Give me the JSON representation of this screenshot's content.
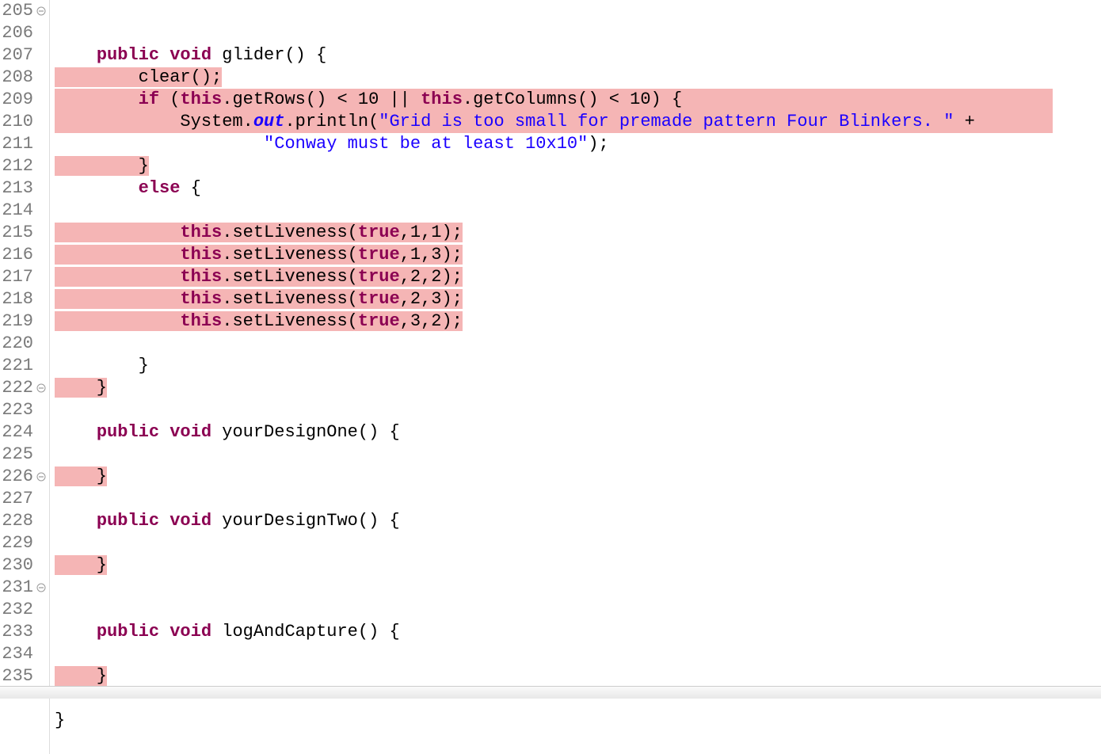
{
  "gutter": {
    "start": 205,
    "end": 235,
    "foldable": [
      205,
      222,
      226,
      231
    ]
  },
  "code": {
    "lines": [
      {
        "n": 205,
        "fold": true,
        "hl": false,
        "segs": [
          {
            "t": "    ",
            "c": "plain"
          },
          {
            "t": "public",
            "c": "kw"
          },
          {
            "t": " ",
            "c": "plain"
          },
          {
            "t": "void",
            "c": "kw"
          },
          {
            "t": " glider() {",
            "c": "plain"
          }
        ]
      },
      {
        "n": 206,
        "fold": false,
        "hl": true,
        "hlStart": 0,
        "segs": [
          {
            "t": "        clear();",
            "c": "plain"
          }
        ]
      },
      {
        "n": 207,
        "fold": false,
        "hl": true,
        "hlStart": 0,
        "hlEnd": 999,
        "segs": [
          {
            "t": "        ",
            "c": "plain"
          },
          {
            "t": "if",
            "c": "kw"
          },
          {
            "t": " (",
            "c": "plain"
          },
          {
            "t": "this",
            "c": "kw"
          },
          {
            "t": ".getRows() < 10 || ",
            "c": "plain"
          },
          {
            "t": "this",
            "c": "kw"
          },
          {
            "t": ".getColumns() < 10) {",
            "c": "plain"
          }
        ]
      },
      {
        "n": 208,
        "fold": false,
        "hl": true,
        "hlStart": 0,
        "hlEnd": 999,
        "segs": [
          {
            "t": "            System.",
            "c": "plain"
          },
          {
            "t": "out",
            "c": "static-field"
          },
          {
            "t": ".println(",
            "c": "plain"
          },
          {
            "t": "\"Grid is too small for premade pattern Four Blinkers. \"",
            "c": "str"
          },
          {
            "t": " +",
            "c": "plain"
          }
        ]
      },
      {
        "n": 209,
        "fold": false,
        "hl": false,
        "segs": [
          {
            "t": "                    ",
            "c": "plain"
          },
          {
            "t": "\"Conway must be at least 10x10\"",
            "c": "str"
          },
          {
            "t": ");",
            "c": "plain"
          }
        ]
      },
      {
        "n": 210,
        "fold": false,
        "hl": true,
        "segs": [
          {
            "t": "        }",
            "c": "plain"
          }
        ]
      },
      {
        "n": 211,
        "fold": false,
        "hl": false,
        "segs": [
          {
            "t": "        ",
            "c": "plain"
          },
          {
            "t": "else",
            "c": "kw"
          },
          {
            "t": " {",
            "c": "plain"
          }
        ]
      },
      {
        "n": 212,
        "fold": false,
        "hl": false,
        "segs": []
      },
      {
        "n": 213,
        "fold": false,
        "hl": true,
        "segs": [
          {
            "t": "            ",
            "c": "plain"
          },
          {
            "t": "this",
            "c": "kw"
          },
          {
            "t": ".setLiveness(",
            "c": "plain"
          },
          {
            "t": "true",
            "c": "kw"
          },
          {
            "t": ",1,1);",
            "c": "plain"
          }
        ]
      },
      {
        "n": 214,
        "fold": false,
        "hl": true,
        "segs": [
          {
            "t": "            ",
            "c": "plain"
          },
          {
            "t": "this",
            "c": "kw"
          },
          {
            "t": ".setLiveness(",
            "c": "plain"
          },
          {
            "t": "true",
            "c": "kw"
          },
          {
            "t": ",1,3);",
            "c": "plain"
          }
        ]
      },
      {
        "n": 215,
        "fold": false,
        "hl": true,
        "segs": [
          {
            "t": "            ",
            "c": "plain"
          },
          {
            "t": "this",
            "c": "kw"
          },
          {
            "t": ".setLiveness(",
            "c": "plain"
          },
          {
            "t": "true",
            "c": "kw"
          },
          {
            "t": ",2,2);",
            "c": "plain"
          }
        ]
      },
      {
        "n": 216,
        "fold": false,
        "hl": true,
        "segs": [
          {
            "t": "            ",
            "c": "plain"
          },
          {
            "t": "this",
            "c": "kw"
          },
          {
            "t": ".setLiveness(",
            "c": "plain"
          },
          {
            "t": "true",
            "c": "kw"
          },
          {
            "t": ",2,3);",
            "c": "plain"
          }
        ]
      },
      {
        "n": 217,
        "fold": false,
        "hl": true,
        "segs": [
          {
            "t": "            ",
            "c": "plain"
          },
          {
            "t": "this",
            "c": "kw"
          },
          {
            "t": ".setLiveness(",
            "c": "plain"
          },
          {
            "t": "true",
            "c": "kw"
          },
          {
            "t": ",3,2);",
            "c": "plain"
          }
        ]
      },
      {
        "n": 218,
        "fold": false,
        "hl": false,
        "segs": []
      },
      {
        "n": 219,
        "fold": false,
        "hl": false,
        "segs": [
          {
            "t": "        }",
            "c": "plain"
          }
        ]
      },
      {
        "n": 220,
        "fold": false,
        "hl": true,
        "segs": [
          {
            "t": "    }",
            "c": "plain"
          }
        ]
      },
      {
        "n": 221,
        "fold": false,
        "hl": false,
        "segs": []
      },
      {
        "n": 222,
        "fold": true,
        "hl": false,
        "segs": [
          {
            "t": "    ",
            "c": "plain"
          },
          {
            "t": "public",
            "c": "kw"
          },
          {
            "t": " ",
            "c": "plain"
          },
          {
            "t": "void",
            "c": "kw"
          },
          {
            "t": " yourDesignOne() {",
            "c": "plain"
          }
        ]
      },
      {
        "n": 223,
        "fold": false,
        "hl": false,
        "segs": []
      },
      {
        "n": 224,
        "fold": false,
        "hl": true,
        "segs": [
          {
            "t": "    }",
            "c": "plain"
          }
        ]
      },
      {
        "n": 225,
        "fold": false,
        "hl": false,
        "segs": []
      },
      {
        "n": 226,
        "fold": true,
        "hl": false,
        "segs": [
          {
            "t": "    ",
            "c": "plain"
          },
          {
            "t": "public",
            "c": "kw"
          },
          {
            "t": " ",
            "c": "plain"
          },
          {
            "t": "void",
            "c": "kw"
          },
          {
            "t": " yourDesignTwo() {",
            "c": "plain"
          }
        ]
      },
      {
        "n": 227,
        "fold": false,
        "hl": false,
        "segs": []
      },
      {
        "n": 228,
        "fold": false,
        "hl": true,
        "segs": [
          {
            "t": "    }",
            "c": "plain"
          }
        ]
      },
      {
        "n": 229,
        "fold": false,
        "hl": false,
        "segs": []
      },
      {
        "n": 230,
        "fold": false,
        "hl": false,
        "segs": []
      },
      {
        "n": 231,
        "fold": true,
        "hl": false,
        "segs": [
          {
            "t": "    ",
            "c": "plain"
          },
          {
            "t": "public",
            "c": "kw"
          },
          {
            "t": " ",
            "c": "plain"
          },
          {
            "t": "void",
            "c": "kw"
          },
          {
            "t": " logAndCapture() {",
            "c": "plain"
          }
        ]
      },
      {
        "n": 232,
        "fold": false,
        "hl": false,
        "segs": []
      },
      {
        "n": 233,
        "fold": false,
        "hl": true,
        "segs": [
          {
            "t": "    }",
            "c": "plain"
          }
        ]
      },
      {
        "n": 234,
        "fold": false,
        "hl": false,
        "segs": []
      },
      {
        "n": 235,
        "fold": false,
        "hl": false,
        "segs": [
          {
            "t": "}",
            "c": "plain"
          }
        ]
      }
    ]
  }
}
